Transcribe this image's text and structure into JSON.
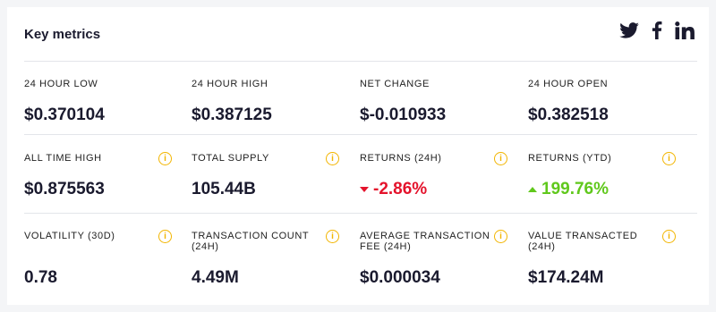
{
  "header": {
    "title": "Key metrics",
    "social": [
      "twitter-icon",
      "facebook-icon",
      "linkedin-icon"
    ]
  },
  "colors": {
    "positive": "#60c81c",
    "negative": "#e4132c",
    "info": "#f2b500"
  },
  "metrics": [
    {
      "label": "24 HOUR LOW",
      "value": "$0.370104",
      "info": false
    },
    {
      "label": "24 HOUR HIGH",
      "value": "$0.387125",
      "info": false
    },
    {
      "label": "NET CHANGE",
      "value": "$-0.010933",
      "info": false
    },
    {
      "label": "24 HOUR OPEN",
      "value": "$0.382518",
      "info": false
    },
    {
      "label": "ALL TIME HIGH",
      "value": "$0.875563",
      "info": true
    },
    {
      "label": "TOTAL SUPPLY",
      "value": "105.44B",
      "info": true
    },
    {
      "label": "RETURNS (24H)",
      "value": "-2.86%",
      "info": true,
      "trend": "down"
    },
    {
      "label": "RETURNS (YTD)",
      "value": "199.76%",
      "info": true,
      "trend": "up"
    },
    {
      "label": "VOLATILITY (30D)",
      "value": "0.78",
      "info": true
    },
    {
      "label": "TRANSACTION COUNT (24H)",
      "value": "4.49M",
      "info": true
    },
    {
      "label": "AVERAGE TRANSACTION FEE (24H)",
      "value": "$0.000034",
      "info": true
    },
    {
      "label": "VALUE TRANSACTED (24H)",
      "value": "$174.24M",
      "info": true
    }
  ],
  "info_symbol": "i"
}
